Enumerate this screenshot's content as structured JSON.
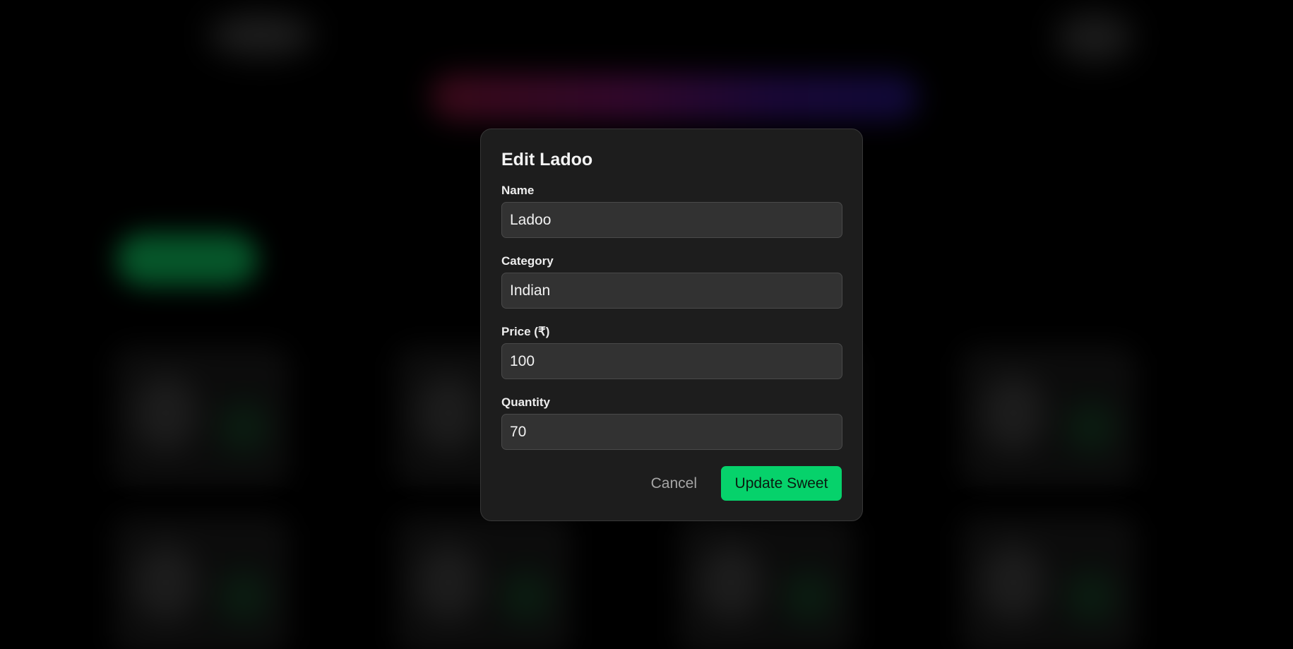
{
  "modal": {
    "title": "Edit Ladoo",
    "fields": {
      "name": {
        "label": "Name",
        "value": "Ladoo"
      },
      "category": {
        "label": "Category",
        "value": "Indian"
      },
      "price": {
        "label": "Price (₹)",
        "value": "100"
      },
      "quantity": {
        "label": "Quantity",
        "value": "70"
      }
    },
    "actions": {
      "cancel_label": "Cancel",
      "submit_label": "Update Sweet"
    }
  },
  "colors": {
    "page_background": "#000000",
    "modal_background": "#1d1d1d",
    "input_background": "#323232",
    "accent": "#06d26b"
  }
}
